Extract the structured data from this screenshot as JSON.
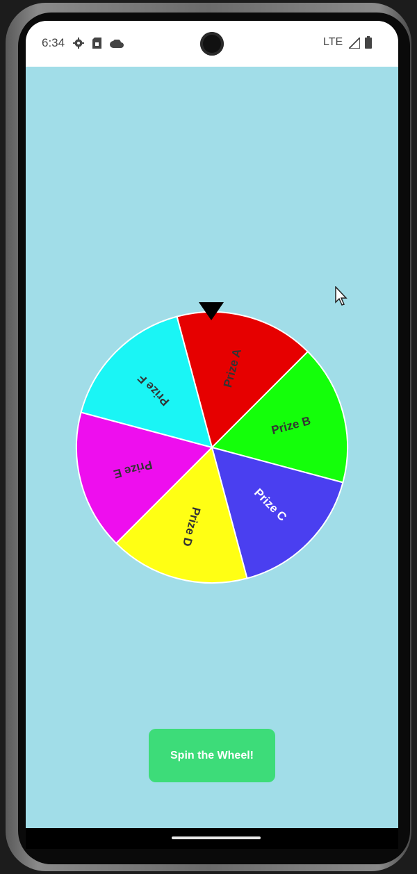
{
  "status_bar": {
    "time": "6:34",
    "network": "LTE",
    "icons": [
      "gear-icon",
      "sim-card-icon",
      "cloud-icon",
      "signal-icon",
      "battery-icon"
    ]
  },
  "app": {
    "background": "#a1dde8",
    "spin_button_label": "Spin the Wheel!",
    "spin_button_color": "#3ddc79"
  },
  "wheel": {
    "segments": [
      {
        "label": "Prize A",
        "color": "#e60000",
        "text_color": "#333333"
      },
      {
        "label": "Prize B",
        "color": "#14ff0a",
        "text_color": "#333333"
      },
      {
        "label": "Prize C",
        "color": "#4a3ff0",
        "text_color": "#ffffff"
      },
      {
        "label": "Prize D",
        "color": "#ffff14",
        "text_color": "#333333"
      },
      {
        "label": "Prize E",
        "color": "#ee0eee",
        "text_color": "#333333"
      },
      {
        "label": "Prize F",
        "color": "#1af5f5",
        "text_color": "#333333"
      }
    ],
    "pointer_color": "#000000"
  }
}
